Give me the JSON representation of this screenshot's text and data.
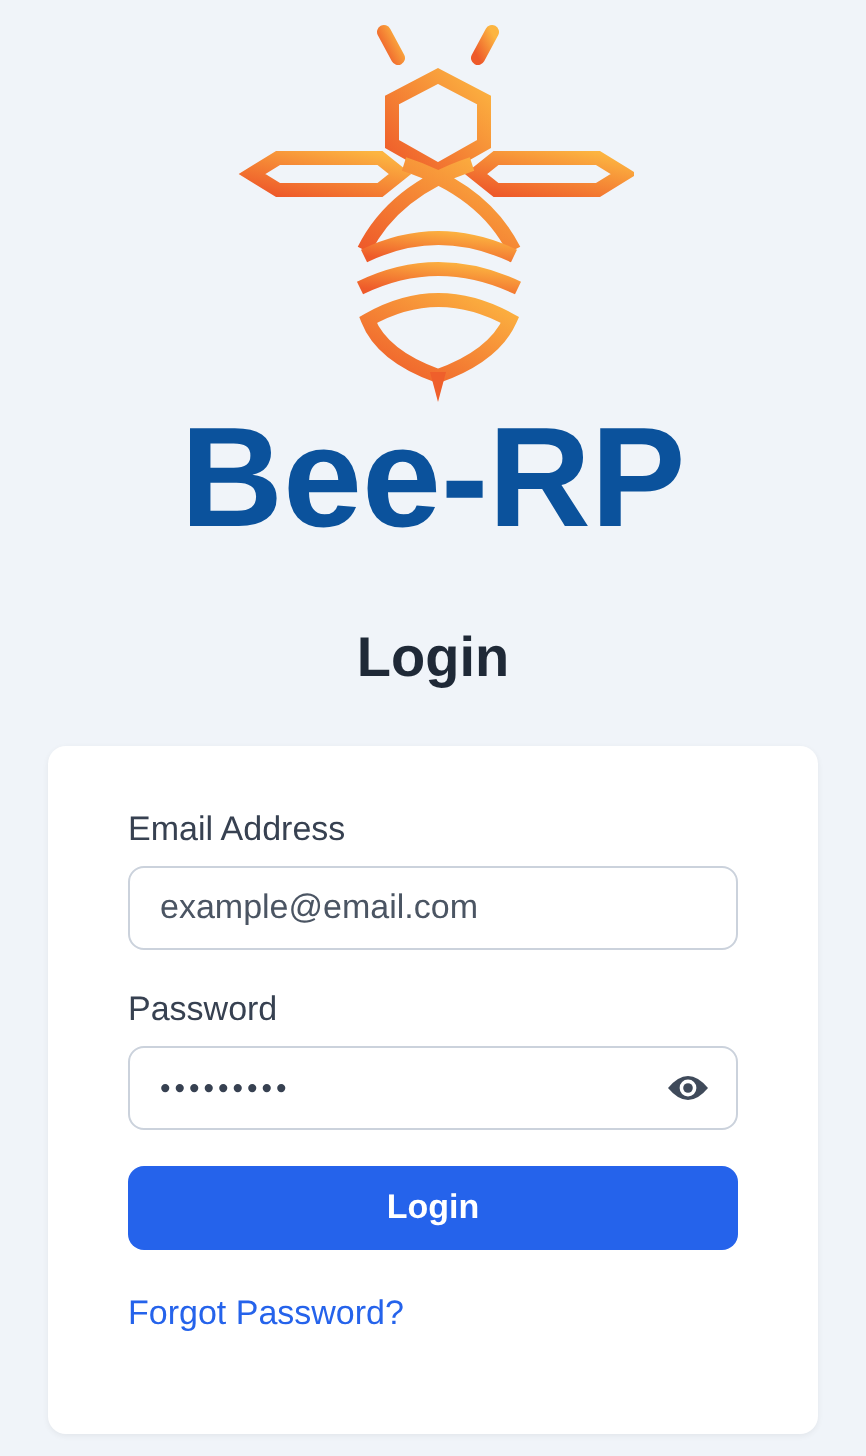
{
  "brand": {
    "name": "Bee-RP"
  },
  "heading": "Login",
  "form": {
    "email": {
      "kind": "email",
      "label": "Email Address",
      "placeholder": "example@email.com"
    },
    "password": {
      "kind": "password",
      "label": "Password",
      "value": "•••••••••"
    },
    "submit": "Login",
    "forgot_link": "Forgot Password?"
  }
}
